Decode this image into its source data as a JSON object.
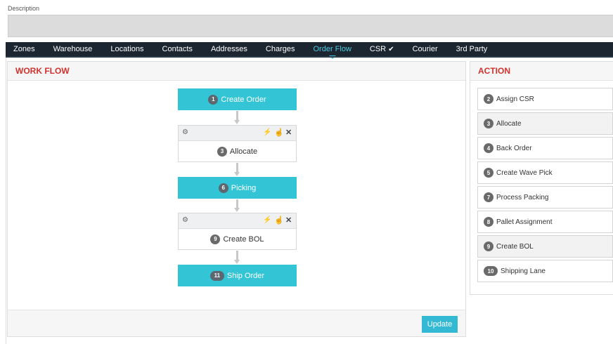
{
  "description": {
    "label": "Description",
    "value": ""
  },
  "tabs": [
    {
      "label": "Zones",
      "active": false,
      "check": ""
    },
    {
      "label": "Warehouse",
      "active": false,
      "check": ""
    },
    {
      "label": "Locations",
      "active": false,
      "check": ""
    },
    {
      "label": "Contacts",
      "active": false,
      "check": ""
    },
    {
      "label": "Addresses",
      "active": false,
      "check": ""
    },
    {
      "label": "Charges",
      "active": false,
      "check": ""
    },
    {
      "label": "Order Flow",
      "active": true,
      "check": ""
    },
    {
      "label": "CSR",
      "active": false,
      "check": "✔"
    },
    {
      "label": "Courier",
      "active": false,
      "check": ""
    },
    {
      "label": "3rd Party",
      "active": false,
      "check": ""
    }
  ],
  "workflow": {
    "title": "WORK FLOW",
    "nodes": [
      {
        "num": "1",
        "label": "Create Order",
        "type": "primary"
      },
      {
        "num": "3",
        "label": "Allocate",
        "type": "secondary"
      },
      {
        "num": "6",
        "label": "Picking",
        "type": "primary"
      },
      {
        "num": "9",
        "label": "Create BOL",
        "type": "secondary"
      },
      {
        "num": "11",
        "label": "Ship Order",
        "type": "primary"
      }
    ],
    "update_label": "Update"
  },
  "action": {
    "title": "ACTION",
    "items": [
      {
        "num": "2",
        "label": "Assign CSR"
      },
      {
        "num": "3",
        "label": "Allocate"
      },
      {
        "num": "4",
        "label": "Back Order"
      },
      {
        "num": "5",
        "label": "Create Wave Pick"
      },
      {
        "num": "7",
        "label": "Process Packing"
      },
      {
        "num": "8",
        "label": "Pallet Assignment"
      },
      {
        "num": "9",
        "label": "Create BOL"
      },
      {
        "num": "10",
        "label": "Shipping Lane"
      }
    ]
  },
  "icons": {
    "gear": "gear-icon",
    "plug": "plug-icon",
    "thumb": "thumbs-up-icon",
    "close": "close-icon",
    "check": "check-icon"
  },
  "colors": {
    "accent": "#33c4d6",
    "nav_bg": "#1c2631",
    "active_tab": "#4ecbe0",
    "heading_red": "#d2322d"
  }
}
